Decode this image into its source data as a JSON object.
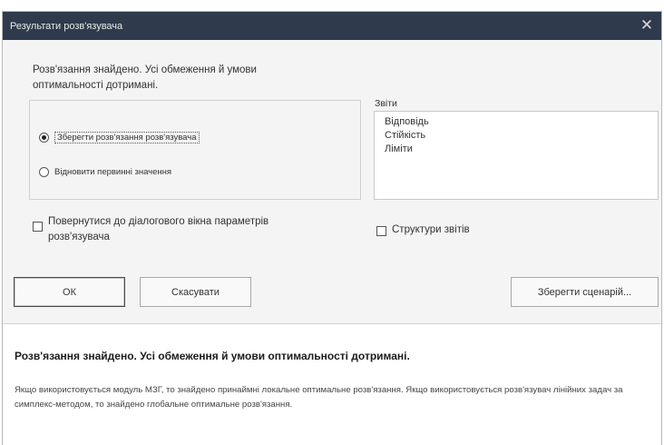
{
  "window": {
    "title": "Результати розв'язувача",
    "close_glyph": "✕"
  },
  "message": {
    "line1": "Розв'язання знайдено. Усі обмеження й умови",
    "line2": "оптимальності дотримані."
  },
  "options": {
    "keep_solution": "Зберегти розв'язання розв'язувача",
    "keep_solution_selected": true,
    "restore_original": "Відновити первинні значення",
    "restore_original_selected": false
  },
  "reports": {
    "label": "Звіти",
    "items": [
      "Відповідь",
      "Стійкість",
      "Ліміти"
    ]
  },
  "checkboxes": {
    "return_to_dialog_line1": "Повернутися до діалогового вікна параметрів",
    "return_to_dialog_line2": "розв'язувача",
    "return_to_dialog_checked": false,
    "outline_reports": "Структури звітів",
    "outline_reports_checked": false
  },
  "buttons": {
    "ok": "ОК",
    "cancel": "Скасувати",
    "save_scenario": "Зберегти сценарій..."
  },
  "info": {
    "title": "Розв'язання знайдено. Усі обмеження й умови оптимальності дотримані.",
    "body": "Якщо використовується модуль МЗГ, то знайдено принаймні локальне оптимальне розв'язання. Якщо використовується розв'язувач лінійних задач за симплекс-методом, то знайдено глобальне оптимальне розв'язання."
  },
  "colors": {
    "titlebar": "#2f3a4c",
    "dialog_bg": "#f4f4f4",
    "panel_bg": "#ffffff"
  }
}
